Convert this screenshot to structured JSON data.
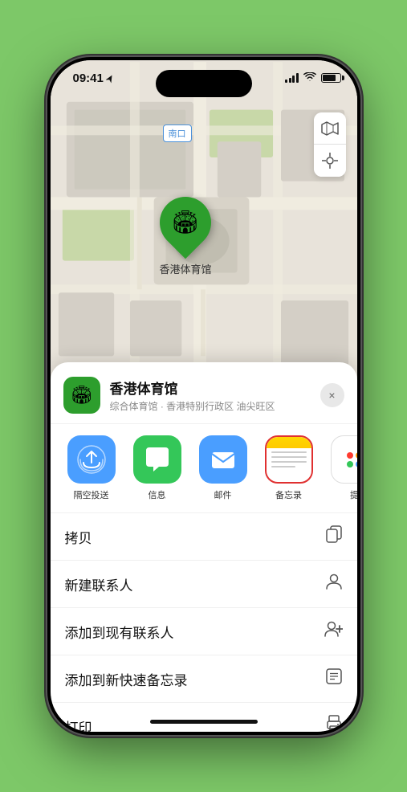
{
  "status_bar": {
    "time": "09:41",
    "location_arrow": "▶"
  },
  "map": {
    "label": "南口"
  },
  "place": {
    "name": "香港体育馆",
    "subtitle": "综合体育馆 · 香港特别行政区 油尖旺区",
    "icon": "🏟"
  },
  "share_items": [
    {
      "id": "airdrop",
      "label": "隔空投送",
      "selected": false
    },
    {
      "id": "messages",
      "label": "信息",
      "selected": false
    },
    {
      "id": "mail",
      "label": "邮件",
      "selected": false
    },
    {
      "id": "notes",
      "label": "备忘录",
      "selected": true
    },
    {
      "id": "more",
      "label": "提",
      "selected": false
    }
  ],
  "actions": [
    {
      "label": "拷贝",
      "icon": "copy"
    },
    {
      "label": "新建联系人",
      "icon": "person"
    },
    {
      "label": "添加到现有联系人",
      "icon": "person-add"
    },
    {
      "label": "添加到新快速备忘录",
      "icon": "note"
    },
    {
      "label": "打印",
      "icon": "print"
    }
  ],
  "close_button_label": "×"
}
